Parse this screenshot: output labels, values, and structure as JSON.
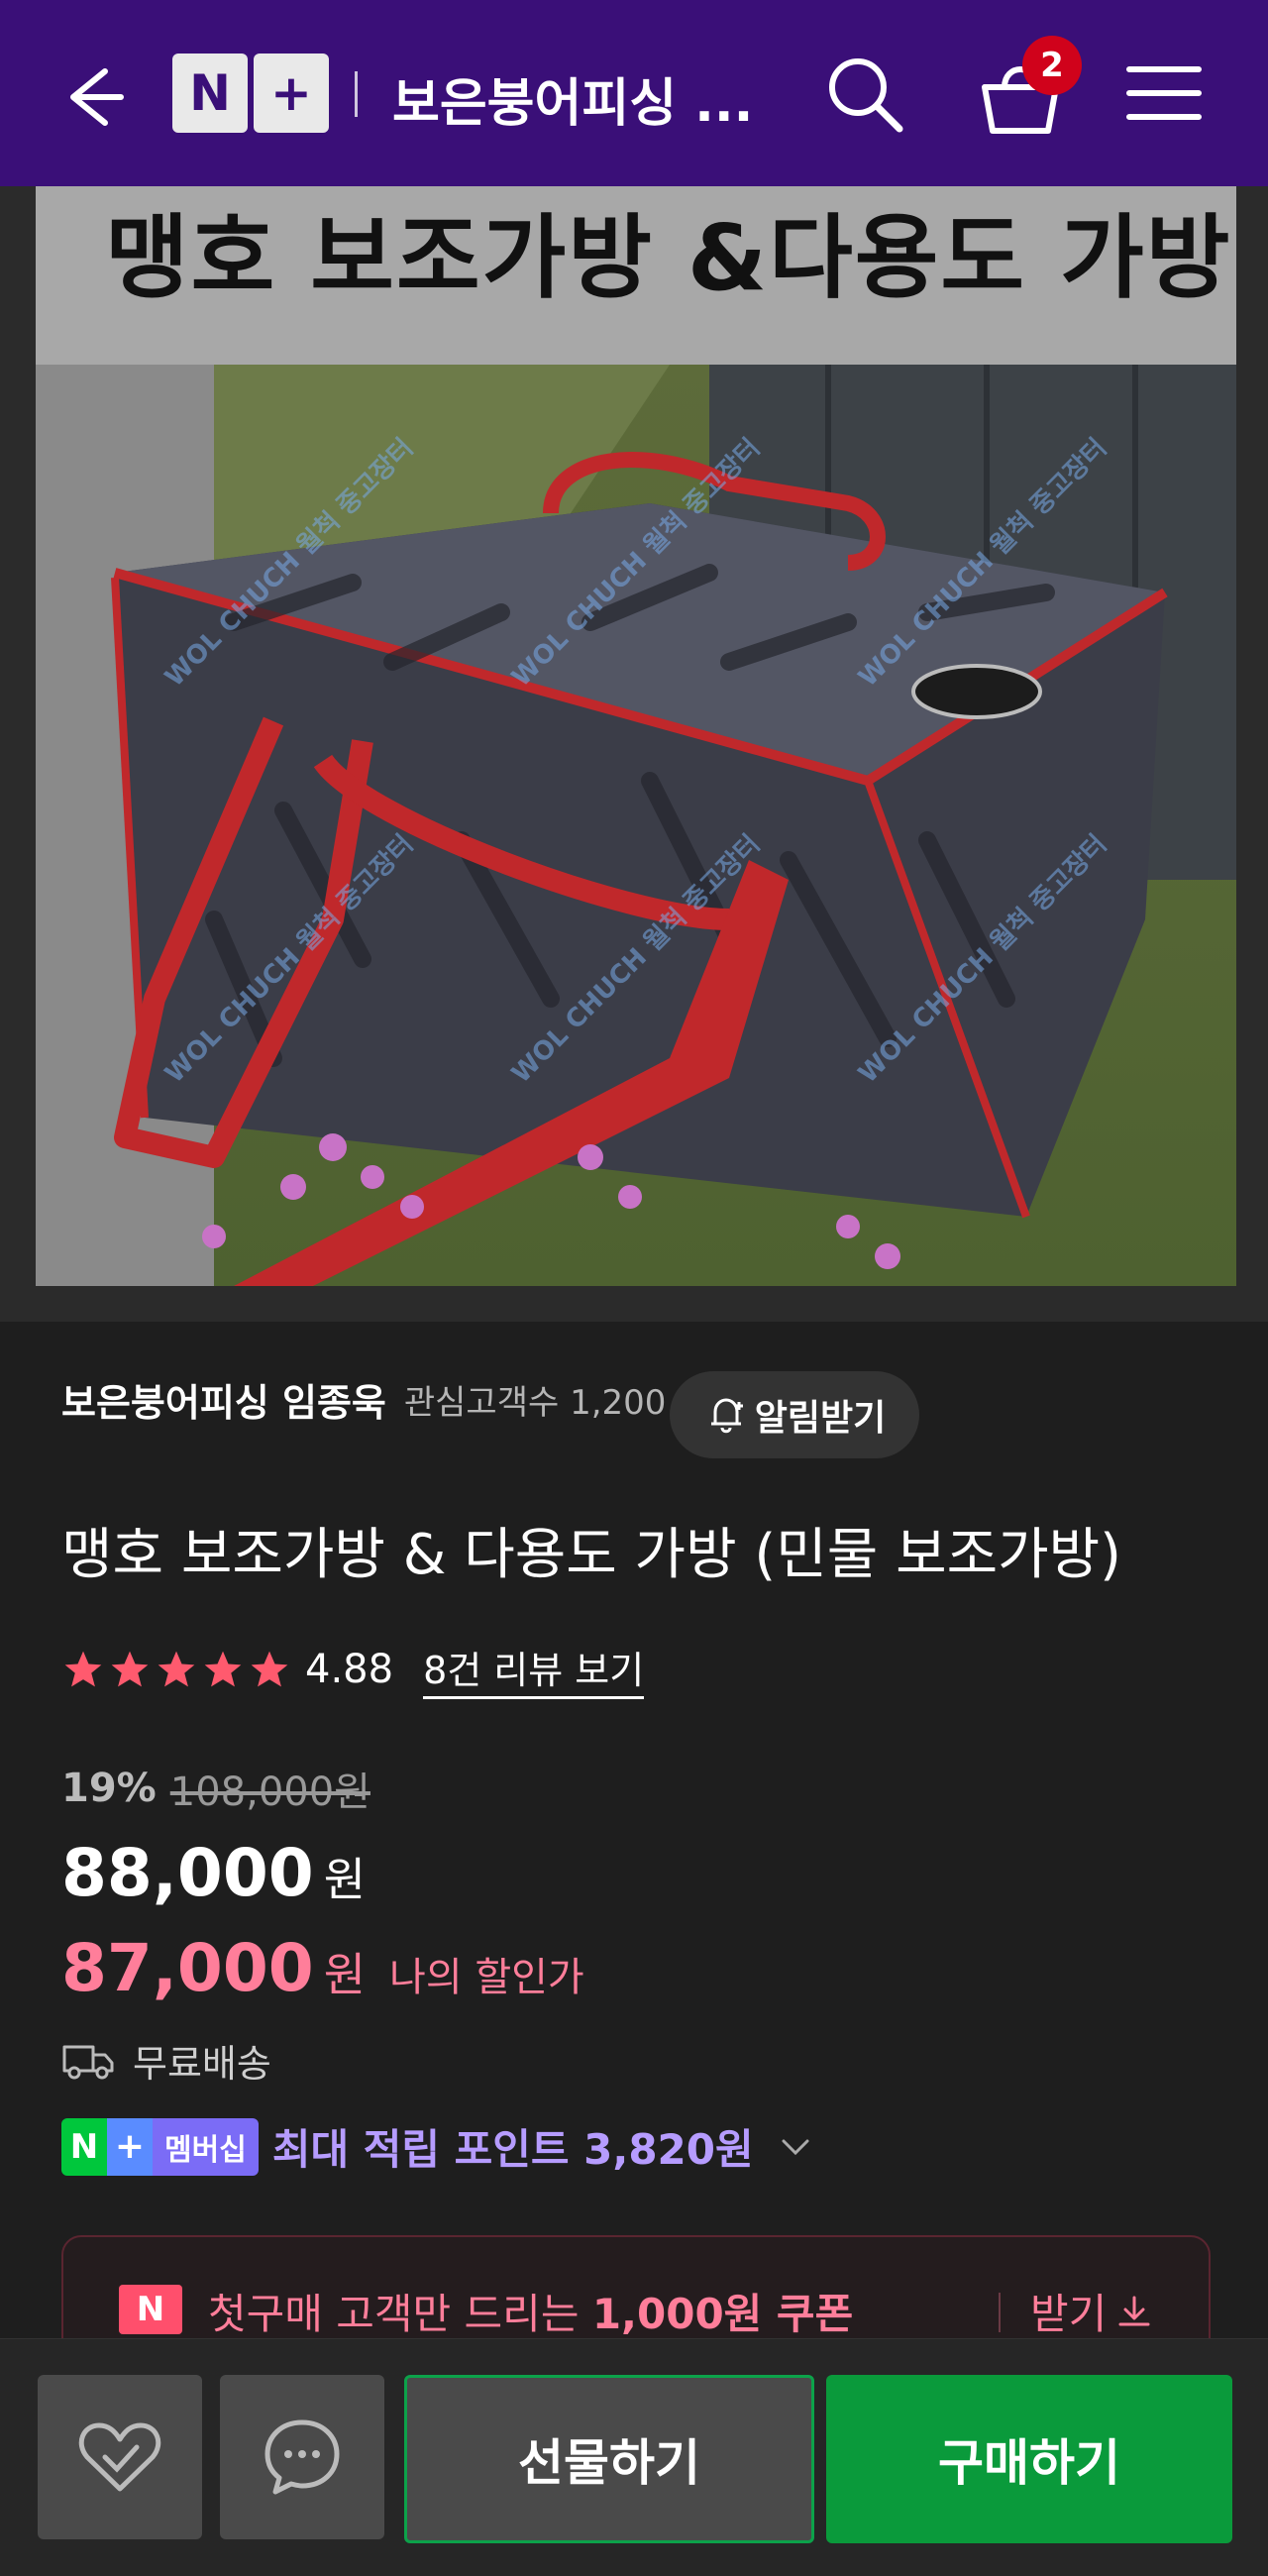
{
  "header": {
    "title": "보은붕어피싱 ...",
    "logo_letter": "N",
    "logo_plus": "+",
    "cart_count": "2",
    "icons": [
      "back-arrow-icon",
      "search-icon",
      "cart-icon",
      "menu-icon"
    ],
    "background_color": "#3a0f78"
  },
  "product_image": {
    "banner_text": "맹호 보조가방 &다용도 가방",
    "watermark_lines": [
      "WOL CHUCH 월척",
      "중고장터"
    ]
  },
  "seller": {
    "name": "보은붕어피싱 임종욱",
    "followers": "관심고객수 1,200",
    "alarm_label": "알림받기"
  },
  "product": {
    "title": "맹호 보조가방 & 다용도 가방 (민물 보조가방)",
    "rating": "4.88",
    "review_link": "8건 리뷰 보기",
    "stars": 5,
    "discount_rate": "19%",
    "original_price": "108,000원",
    "price": "88,000",
    "price_unit": "원",
    "my_price": "87,000",
    "my_price_unit": "원",
    "my_price_label": "나의 할인가",
    "shipping": "무료배송",
    "membership_label": "멤버십",
    "membership_points": "최대 적립 포인트 3,820원"
  },
  "coupon": {
    "badge": "N",
    "text_prefix": "첫구매 고객만 드리는 ",
    "text_bold": "1,000원 쿠폰",
    "get_label": "받기"
  },
  "bottom_bar": {
    "gift_label": "선물하기",
    "buy_label": "구매하기",
    "accent_color": "#0a9a3b"
  }
}
